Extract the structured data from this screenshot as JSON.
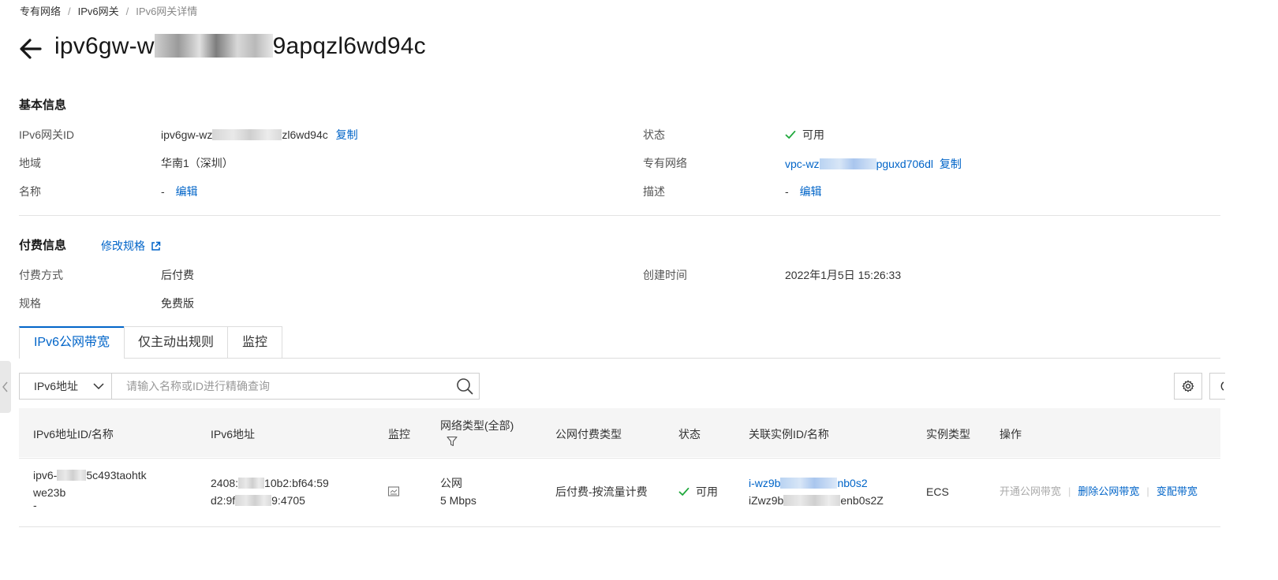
{
  "breadcrumb": {
    "items": [
      "专有网络",
      "IPv6网关"
    ],
    "separator": "/",
    "current": "IPv6网关详情"
  },
  "header": {
    "title_prefix": "ipv6gw-w",
    "title_suffix": "9apqzl6wd94c"
  },
  "basic_info": {
    "title": "基本信息",
    "id_label": "IPv6网关ID",
    "id_prefix": "ipv6gw-wz",
    "id_suffix": "zl6wd94c",
    "copy": "复制",
    "status_label": "状态",
    "status_value": "可用",
    "region_label": "地域",
    "region_value": "华南1（深圳）",
    "vpc_label": "专有网络",
    "vpc_prefix": "vpc-wz",
    "vpc_suffix": "pguxd706dl",
    "name_label": "名称",
    "name_value": "-",
    "edit": "编辑",
    "desc_label": "描述",
    "desc_value": "-"
  },
  "billing": {
    "title": "付费信息",
    "modify_spec": "修改规格",
    "pay_label": "付费方式",
    "pay_value": "后付费",
    "created_label": "创建时间",
    "created_value": "2022年1月5日 15:26:33",
    "spec_label": "规格",
    "spec_value": "免费版"
  },
  "tabs": [
    {
      "label": "IPv6公网带宽",
      "active": true
    },
    {
      "label": "仅主动出规则",
      "active": false
    },
    {
      "label": "监控",
      "active": false
    }
  ],
  "search": {
    "select_value": "IPv6地址",
    "placeholder": "请输入名称或ID进行精确查询"
  },
  "table": {
    "headers": {
      "id_name": "IPv6地址ID/名称",
      "address": "IPv6地址",
      "monitor": "监控",
      "net_type": "网络类型(全部)",
      "billing": "公网付费类型",
      "status": "状态",
      "instance": "关联实例ID/名称",
      "instance_type": "实例类型",
      "ops": "操作"
    },
    "rows": [
      {
        "id_line1_prefix": "ipv6-",
        "id_line1_suffix": "5c493taohtk",
        "id_line2": "we23b",
        "name": "-",
        "addr_line1_prefix": "2408:",
        "addr_line1_suffix": "10b2:bf64:59",
        "addr_line2_prefix": "d2:9f",
        "addr_line2_suffix": "9:4705",
        "net_type": "公网",
        "bandwidth": "5 Mbps",
        "billing": "后付费-按流量计费",
        "status": "可用",
        "instance_id_prefix": "i-wz9b",
        "instance_id_suffix": "nb0s2",
        "instance_name_prefix": "iZwz9b",
        "instance_name_suffix": "enb0s2Z",
        "instance_type": "ECS",
        "op_open": "开通公网带宽",
        "op_delete": "删除公网带宽",
        "op_change": "变配带宽"
      }
    ]
  },
  "colors": {
    "link": "#0064c8",
    "success": "#1fa83c",
    "header_bg": "#f5f5f5"
  }
}
